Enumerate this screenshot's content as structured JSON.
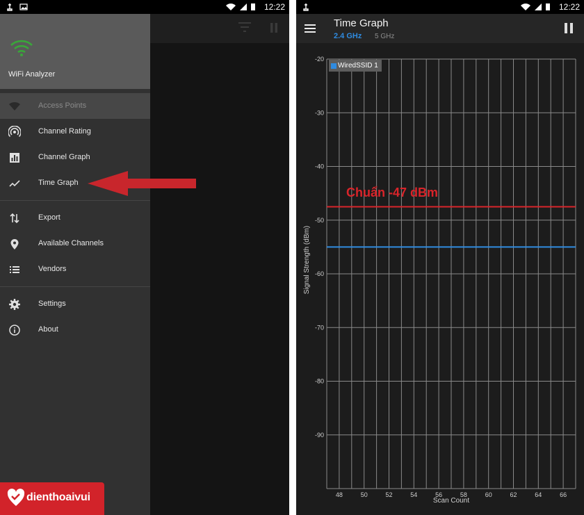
{
  "status_bar": {
    "left_time": "12:22",
    "right_time": "12:22"
  },
  "drawer": {
    "app_name": "WiFi Analyzer",
    "items": [
      {
        "label": "Access Points",
        "icon": "wifi-icon",
        "active": true
      },
      {
        "label": "Channel Rating",
        "icon": "antenna-icon"
      },
      {
        "label": "Channel Graph",
        "icon": "bar-chart-icon"
      },
      {
        "label": "Time Graph",
        "icon": "line-chart-icon"
      },
      {
        "label": "Export",
        "icon": "swap-vertical-icon"
      },
      {
        "label": "Available Channels",
        "icon": "location-pin-icon"
      },
      {
        "label": "Vendors",
        "icon": "list-icon"
      },
      {
        "label": "Settings",
        "icon": "gear-icon"
      },
      {
        "label": "About",
        "icon": "info-icon"
      }
    ]
  },
  "toolbar": {
    "title": "Time Graph",
    "band_primary": "2.4 GHz",
    "band_secondary": "5 GHz"
  },
  "annotation": {
    "text": "Chuẩn -47 dBm",
    "value": -47
  },
  "watermark": {
    "brand": "dienthoaivui"
  },
  "colors": {
    "accent_blue": "#2f8be0",
    "annotation_red": "#d9242a",
    "brand_red": "#d2232a"
  },
  "chart_data": {
    "type": "line",
    "xlabel": "Scan Count",
    "ylabel": "Signal Strength (dBm)",
    "xlim": [
      47,
      67
    ],
    "ylim": [
      -100,
      -20
    ],
    "x_ticks": [
      48,
      50,
      52,
      54,
      56,
      58,
      60,
      62,
      64,
      66
    ],
    "y_ticks": [
      -20,
      -30,
      -40,
      -50,
      -60,
      -70,
      -80,
      -90
    ],
    "grid": true,
    "legend": {
      "placement": "top-left",
      "entries": [
        "WiredSSID 1"
      ]
    },
    "series": [
      {
        "name": "WiredSSID 1",
        "color": "#2f8be0",
        "x": [
          47,
          67
        ],
        "y": [
          -55,
          -55
        ]
      }
    ],
    "reference_lines": [
      {
        "label": "Chuẩn -47 dBm",
        "color": "#d9242a",
        "y": -47.5
      }
    ]
  }
}
